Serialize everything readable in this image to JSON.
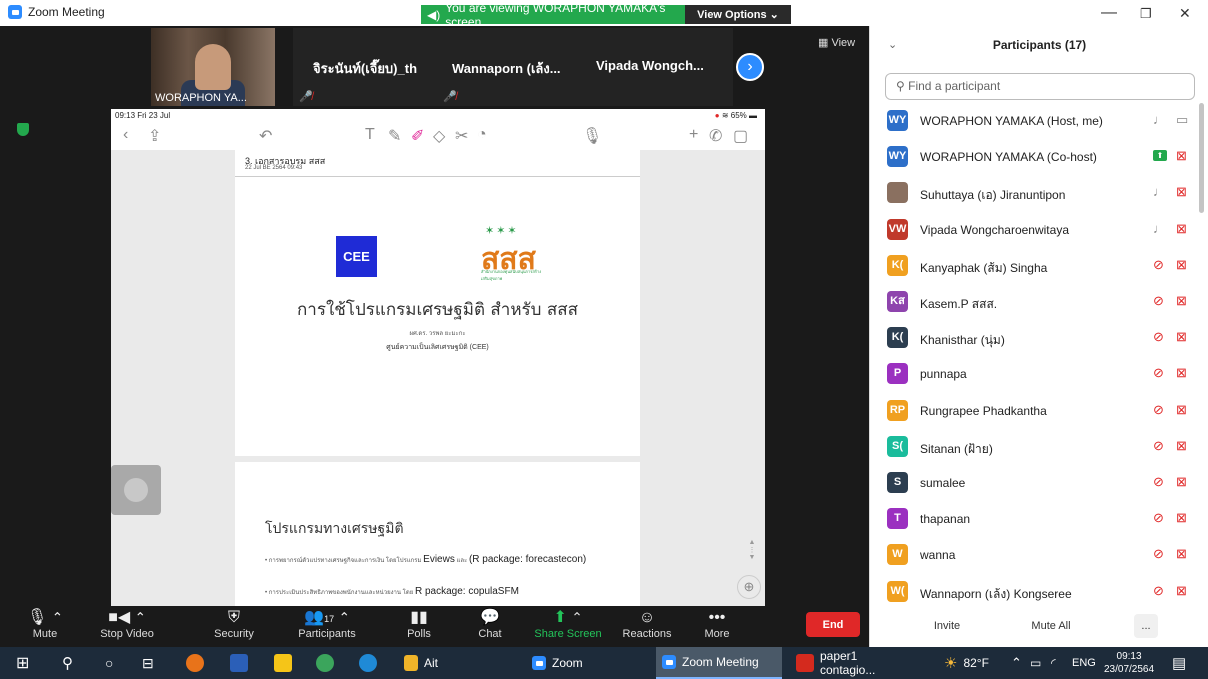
{
  "titlebar": {
    "app_title": "Zoom Meeting",
    "viewing_banner": "You are viewing WORAPHON YAMAKA's screen",
    "view_options": "View Options ⌄",
    "minimize": "—",
    "restore": "❐",
    "close": "✕"
  },
  "thumbnails": [
    {
      "name": "WORAPHON YA..."
    },
    {
      "name": "จิระนันท์(เจี๊ยบ)_th"
    },
    {
      "name": "Wannaporn (เล้ง..."
    },
    {
      "name": "Vipada  Wongch..."
    }
  ],
  "view_button": "View",
  "shared_screen": {
    "status_time": "09:13  Fri 23 Jul",
    "status_right": "65%",
    "doc_title": "3. เอกสารอบรม สสส",
    "doc_date": "22 Jul BE 2564 09:43",
    "cee_logo": "CEE",
    "sss_logo": "สสส",
    "sss_stars": "✶✶✶",
    "sss_sub": "สำนักงานกองทุนสนับสนุนการสร้างเสริมสุขภาพ",
    "main_title": "การใช้โปรแกรมเศรษฐมิติ สำหรับ สสส",
    "author": "ผศ.ดร. วรพล ยะมะกะ",
    "org": "ศูนย์ความเป็นเลิศเศรษฐมิติ (CEE)",
    "p2_title": "โปรแกรมทางเศรษฐมิติ",
    "bullet1_small": "• การพยากรณ์ตัวแปรทางเศรษฐกิจและการเงิน โดยโปรแกรม ",
    "bullet1_main": "Eviews",
    "bullet1_mid": " และ ",
    "bullet1_end": "(R package: forecastecon)",
    "bullet2_small": "• การประเมินประสิทธิภาพของพนักงานและหน่วยงาน โดย ",
    "bullet2_end": "R package: copulaSFM"
  },
  "toolbar": {
    "mute": "Mute",
    "stop_video": "Stop Video",
    "security": "Security",
    "participants": "Participants",
    "participants_count": "17",
    "polls": "Polls",
    "chat": "Chat",
    "share_screen": "Share Screen",
    "reactions": "Reactions",
    "more": "More",
    "end": "End"
  },
  "panel": {
    "header": "Participants (17)",
    "search_placeholder": "Find a participant",
    "participants": [
      {
        "initials": "WY",
        "name": "WORAPHON YAMAKA (Host, me)",
        "color": "#2d6fc9",
        "mic_muted": false,
        "cam_muted": false
      },
      {
        "initials": "WY",
        "name": "WORAPHON YAMAKA (Co-host)",
        "color": "#2d6fc9",
        "sharing": true,
        "cam_muted": true
      },
      {
        "initials": "",
        "name": "Suhuttaya (เอ) Jiranuntipon",
        "color": "#8a7060",
        "mic_muted": false,
        "cam_muted": true
      },
      {
        "initials": "VW",
        "name": "Vipada Wongcharoenwitaya",
        "color": "#c0392b",
        "mic_muted": false,
        "cam_muted": true
      },
      {
        "initials": "K(",
        "name": "Kanyaphak (ส้ม) Singha",
        "color": "#f0a020",
        "mic_muted": true,
        "cam_muted": true
      },
      {
        "initials": "Kส",
        "name": "Kasem.P สสส.",
        "color": "#8e44ad",
        "mic_muted": true,
        "cam_muted": true
      },
      {
        "initials": "K(",
        "name": "Khanisthar (นุ่ม)",
        "color": "#2c3e50",
        "mic_muted": true,
        "cam_muted": true
      },
      {
        "initials": "P",
        "name": "punnapa",
        "color": "#9b30c0",
        "mic_muted": true,
        "cam_muted": true
      },
      {
        "initials": "RP",
        "name": "Rungrapee Phadkantha",
        "color": "#f0a020",
        "mic_muted": true,
        "cam_muted": true
      },
      {
        "initials": "S(",
        "name": "Sitanan (ฝ้าย)",
        "color": "#1abc9c",
        "mic_muted": true,
        "cam_muted": true
      },
      {
        "initials": "S",
        "name": "sumalee",
        "color": "#2c3e50",
        "mic_muted": true,
        "cam_muted": true
      },
      {
        "initials": "T",
        "name": "thapanan",
        "color": "#9b30c0",
        "mic_muted": true,
        "cam_muted": true
      },
      {
        "initials": "W",
        "name": "wanna",
        "color": "#f0a020",
        "mic_muted": true,
        "cam_muted": true
      },
      {
        "initials": "W(",
        "name": "Wannaporn (เล้ง) Kongseree",
        "color": "#f0a020",
        "mic_muted": true,
        "cam_muted": true
      }
    ],
    "invite": "Invite",
    "mute_all": "Mute All",
    "more": "..."
  },
  "taskbar": {
    "ait": "Ait",
    "zoom": "Zoom",
    "zoom_meeting": "Zoom Meeting",
    "paper": "paper1 contagio...",
    "weather": "82°F",
    "lang": "ENG",
    "time": "09:13",
    "date": "23/07/2564"
  }
}
